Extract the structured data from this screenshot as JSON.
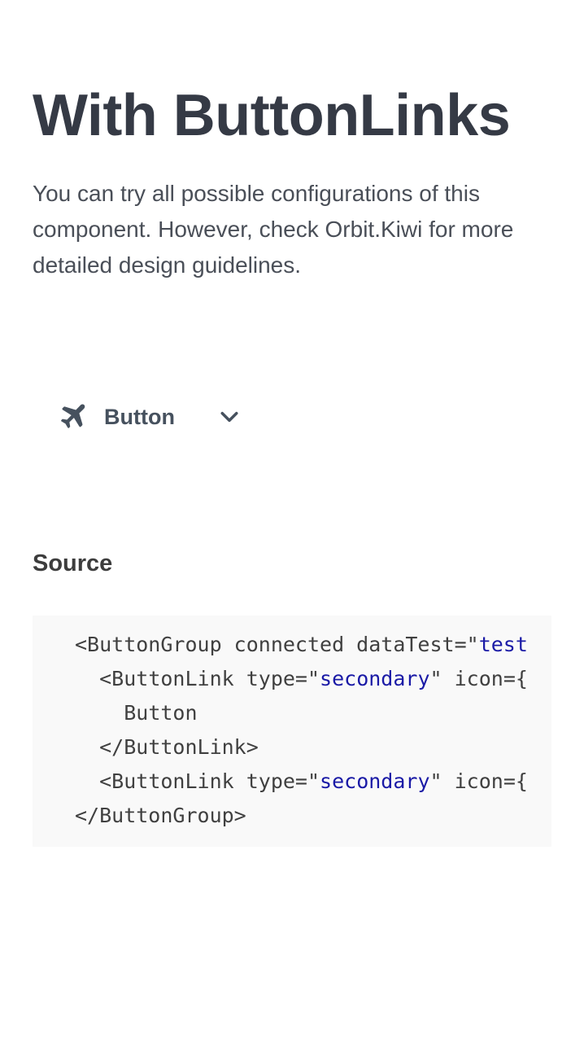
{
  "header": {
    "title": "With ButtonLinks",
    "description": "You can try all possible configurations of this component. However, check Orbit.Kiwi for more detailed design guidelines."
  },
  "demo": {
    "button_label": "Button",
    "button_icon": "airplane-icon",
    "dropdown_icon": "chevron-down-icon"
  },
  "source": {
    "heading": "Source",
    "lines": [
      {
        "indent": "",
        "before": "<ButtonGroup connected dataTest=\"",
        "string": "test",
        "after": ""
      },
      {
        "indent": "  ",
        "before": "<ButtonLink type=\"",
        "string": "secondary",
        "after": "\" icon={"
      },
      {
        "indent": "    ",
        "before": "Button",
        "string": "",
        "after": ""
      },
      {
        "indent": "  ",
        "before": "</ButtonLink>",
        "string": "",
        "after": ""
      },
      {
        "indent": "  ",
        "before": "<ButtonLink type=\"",
        "string": "secondary",
        "after": "\" icon={"
      },
      {
        "indent": "",
        "before": "</ButtonGroup>",
        "string": "",
        "after": ""
      }
    ]
  },
  "colors": {
    "text": "#363d48",
    "button_text": "#46515e",
    "code_background": "#f9f9f9",
    "code_string": "#1a1aa6"
  }
}
